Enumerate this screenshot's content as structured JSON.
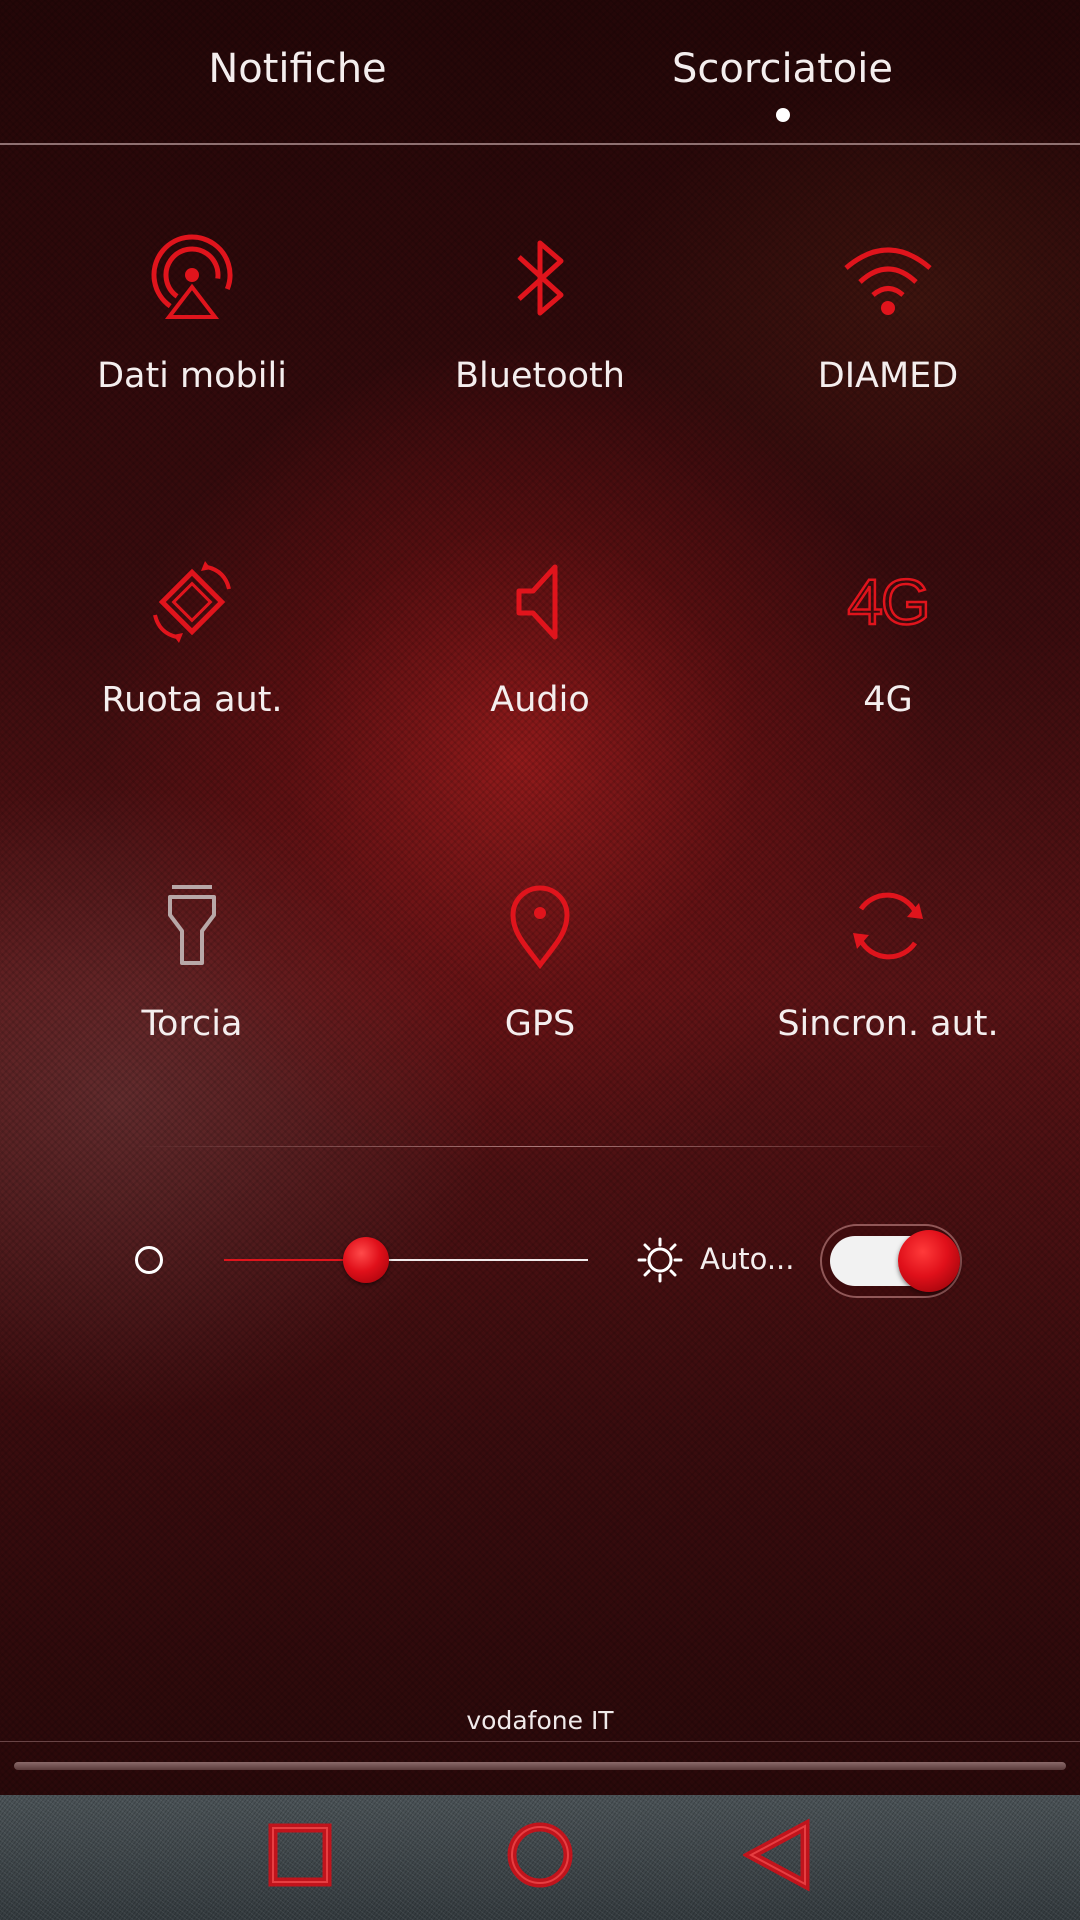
{
  "tabs": {
    "notifications": "Notifiche",
    "shortcuts": "Scorciatoie"
  },
  "tiles": [
    {
      "label": "Dati mobili",
      "icon": "mobile-data-icon"
    },
    {
      "label": "Bluetooth",
      "icon": "bluetooth-icon"
    },
    {
      "label": "DIAMED",
      "icon": "wifi-icon"
    },
    {
      "label": "Ruota aut.",
      "icon": "auto-rotate-icon"
    },
    {
      "label": "Audio",
      "icon": "speaker-icon",
      "icon_text": ""
    },
    {
      "label": "4G",
      "icon": "4g-icon",
      "icon_text": "4G"
    },
    {
      "label": "Torcia",
      "icon": "flashlight-icon"
    },
    {
      "label": "GPS",
      "icon": "location-pin-icon"
    },
    {
      "label": "Sincron. aut.",
      "icon": "sync-icon"
    }
  ],
  "brightness": {
    "level": 0.39,
    "auto_label": "Auto...",
    "auto_enabled": true
  },
  "carrier": "vodafone IT",
  "colors": {
    "accent": "#e0141c",
    "text": "#f4eeee",
    "inactive_icon": "#b8a8a8"
  },
  "nav": {
    "recents": "square-icon",
    "home": "circle-icon",
    "back": "triangle-back-icon"
  }
}
